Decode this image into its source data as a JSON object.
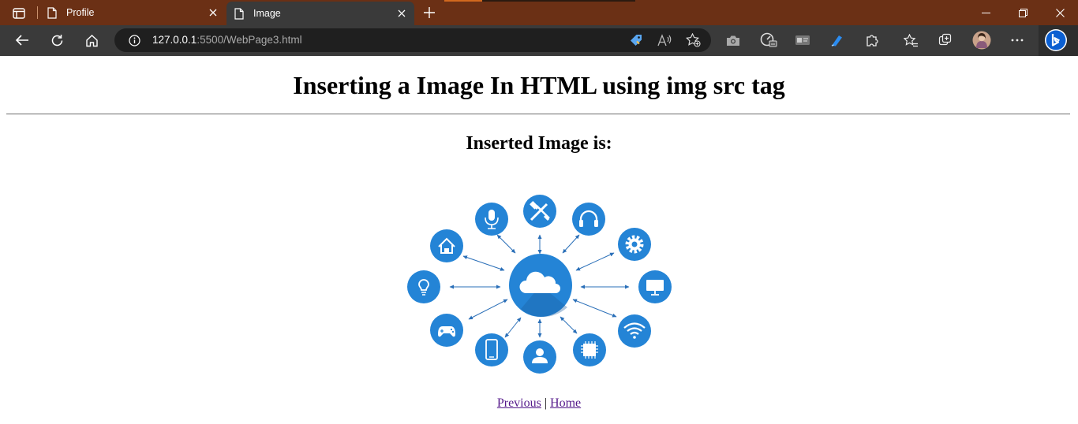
{
  "browser": {
    "tabs": [
      {
        "title": "Profile",
        "active": false
      },
      {
        "title": "Image",
        "active": true
      }
    ],
    "url": {
      "host": "127.0.0.1",
      "rest": ":5500/WebPage3.html"
    }
  },
  "page": {
    "heading": "Inserting a Image In HTML using img src tag",
    "subheading": "Inserted Image is:",
    "image_subject": "cloud-network-icons",
    "links": {
      "previous": "Previous",
      "separator": "|",
      "home": "Home"
    }
  },
  "colors": {
    "tabbar": "#6b3015",
    "toolbar": "#3a3a3a",
    "icon_blue": "#2484d6",
    "link_visited": "#551a8b"
  }
}
